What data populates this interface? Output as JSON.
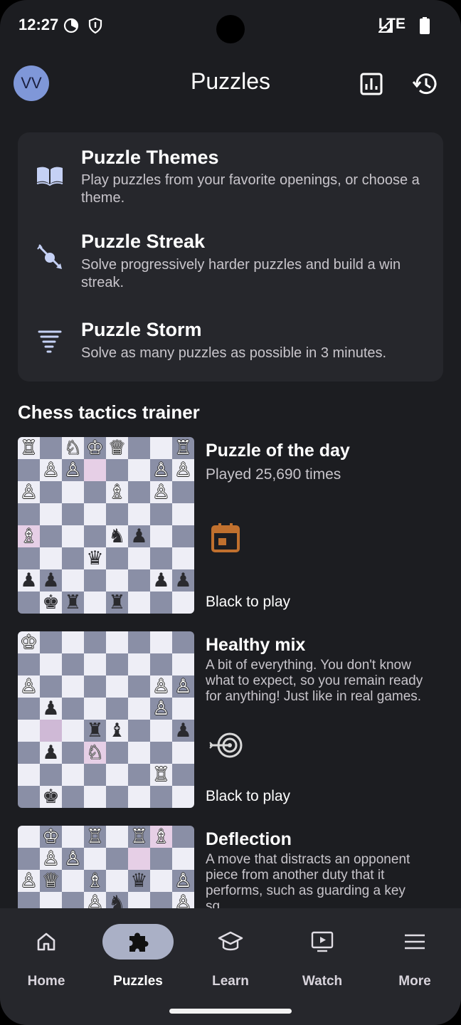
{
  "status": {
    "time": "12:27",
    "network": "LTE"
  },
  "header": {
    "avatar": "VV",
    "title": "Puzzles"
  },
  "menu": [
    {
      "title": "Puzzle Themes",
      "subtitle": "Play puzzles from your favorite openings, or choose a theme.",
      "icon": "book-icon"
    },
    {
      "title": "Puzzle Streak",
      "subtitle": "Solve progressively harder puzzles and build a win streak.",
      "icon": "streak-icon"
    },
    {
      "title": "Puzzle Storm",
      "subtitle": "Solve as many puzzles as possible in 3 minutes.",
      "icon": "storm-icon"
    }
  ],
  "section_title": "Chess tactics trainer",
  "tiles": [
    {
      "title": "Puzzle of the day",
      "subtitle": "Played 25,690 times",
      "turn": "Black to play",
      "icon": "calendar-icon",
      "highlights": [
        "3,1",
        "0,4"
      ],
      "board": [
        "R.NKQ..R",
        ".PP...PP",
        "P...B.P.",
        "........",
        "B...np..",
        "...q....",
        "pp....pp",
        ".kr.r..."
      ]
    },
    {
      "title": "Healthy mix",
      "subtitle": "A bit of everything. You don't know what to expect, so you remain ready for anything! Just like in real games.",
      "turn": "Black to play",
      "icon": "target-icon",
      "highlights": [
        "1,4",
        "3,5"
      ],
      "board": [
        "K.......",
        "........",
        "P.....PP",
        ".p....P.",
        "...rb..p",
        ".p.N....",
        "......R.",
        ".k......"
      ]
    },
    {
      "title": "Deflection",
      "subtitle": "A move that distracts an opponent piece from another duty that it performs, such as guarding a key sq…",
      "turn": "",
      "icon": "",
      "highlights": [
        "6,0",
        "5,1"
      ],
      "board": [
        ".K.R.RB.",
        ".PP.....",
        "PQ.B.q.P",
        "...Pn..P"
      ]
    }
  ],
  "nav": [
    {
      "label": "Home",
      "icon": "home-icon"
    },
    {
      "label": "Puzzles",
      "icon": "puzzle-icon"
    },
    {
      "label": "Learn",
      "icon": "learn-icon"
    },
    {
      "label": "Watch",
      "icon": "watch-icon"
    },
    {
      "label": "More",
      "icon": "menu-icon"
    }
  ]
}
